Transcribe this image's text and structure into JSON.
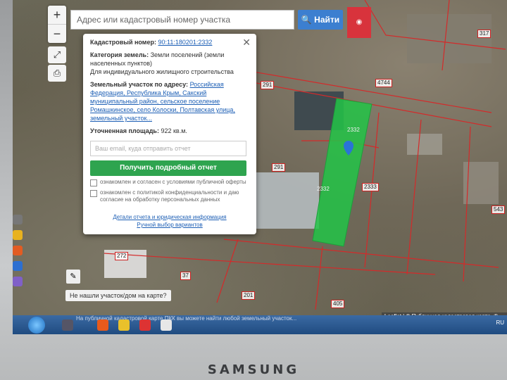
{
  "search": {
    "placeholder": "Адрес или кадастровый номер участка",
    "button_label": "Найти"
  },
  "popup": {
    "cadastral_label": "Кадастровый номер:",
    "cadastral_value": "90:11:180201:2332",
    "category_label": "Категория земель:",
    "category_value": "Земли поселений (земли населенных пунктов)",
    "usage_value": "Для индивидуального жилищного строительства",
    "address_label": "Земельный участок по адресу:",
    "address_value": "Российская Федерация, Республика Крым, Сакский муниципальный район, сельское поселение Ромашкинское, село Колоски, Полтавская улица, земельный участок...",
    "area_label": "Уточненная площадь:",
    "area_value": "922 кв.м.",
    "email_placeholder": "Ваш email, куда отправить отчет",
    "get_report_button": "Получить подробный отчет",
    "checkbox_offer": "ознакомлен и согласен с условиями публичной оферты",
    "checkbox_privacy": "ознакомлен с политикой конфиденциальности и даю согласие на обработку персональных данных",
    "link_details": "Детали отчета и юридическая информация",
    "link_manual": "Ручной выбор вариантов"
  },
  "map": {
    "parcel_labels": [
      "317",
      "4744",
      "291",
      "2332",
      "291",
      "2332",
      "2333",
      "543",
      "272",
      "37",
      "201",
      "405"
    ],
    "not_found_label": "Не нашли участок/дом на карте?",
    "attribution": "Leaflet | © Публичная кадастровая карта, © ..."
  },
  "taskbar": {
    "hint_text": "На публичной кадастровой карте ПКК вы можете найти любой земельный участок...",
    "tray_lang": "RU"
  },
  "monitor_brand": "SAMSUNG",
  "colors": {
    "parcel_green": "#22c447",
    "find_button": "#3c7fd0",
    "report_button": "#2ea44f",
    "parcel_border": "#d42a2a"
  }
}
